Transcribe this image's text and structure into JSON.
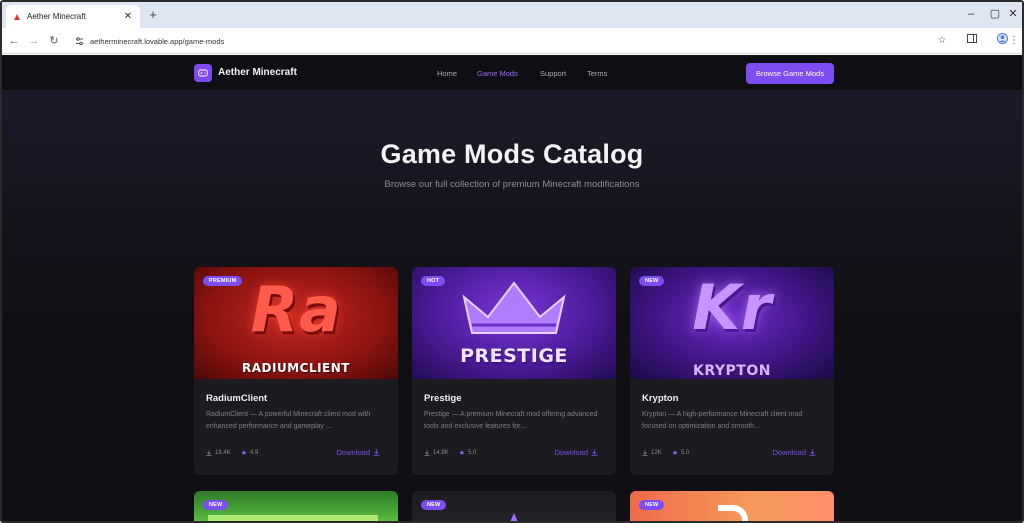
{
  "browser": {
    "tab_title": "Aether Minecraft",
    "tab_close": "✕",
    "new_tab": "+",
    "url": "aetherminecraft.lovable.app/game-mods"
  },
  "site": {
    "brand": "Aether Minecraft",
    "nav": [
      "Home",
      "Game Mods",
      "Support",
      "Terms"
    ],
    "active_nav": "Game Mods",
    "cta": "Browse Game Mods",
    "accent": "#7c4ef2"
  },
  "hero": {
    "title": "Game Mods Catalog",
    "subtitle": "Browse our full collection of premium Minecraft modifications"
  },
  "cards": [
    {
      "badge": "PREMIUM",
      "art_logo": "Ra",
      "art_caption": "RADIUMCLIENT",
      "name": "RadiumClient",
      "desc": "RadiumClient — A powerful Minecraft client mod with enhanced performance and gameplay ...",
      "downloads": "18.4K",
      "rating": "4.9",
      "download_label": "Download"
    },
    {
      "badge": "HOT",
      "art_caption": "PRESTIGE",
      "name": "Prestige",
      "desc": "Prestige — A premium Minecraft mod offering advanced tools and exclusive features for...",
      "downloads": "14.9K",
      "rating": "5.0",
      "download_label": "Download"
    },
    {
      "badge": "NEW",
      "art_logo": "Kr",
      "art_caption": "KRYPTON",
      "name": "Krypton",
      "desc": "Krypton — A high-performance Minecraft client mod focused on optimization and smooth...",
      "downloads": "12K",
      "rating": "5.0",
      "download_label": "Download"
    },
    {
      "badge": "NEW"
    },
    {
      "badge": "NEW"
    },
    {
      "badge": "NEW"
    }
  ]
}
